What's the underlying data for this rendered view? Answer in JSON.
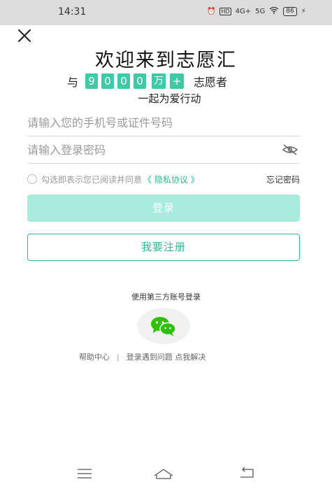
{
  "status_bar": {
    "time": "14:31",
    "icons": [
      "alarm-icon",
      "hd-icon",
      "4g-signal-icon",
      "5g-signal-icon",
      "wifi-icon"
    ],
    "hd_label": "HD",
    "net1_label": "4G+",
    "net2_label": "5G",
    "battery": "86"
  },
  "header": {
    "close_icon": "close-icon",
    "title": "欢迎来到志愿汇",
    "count_prefix": "与",
    "count_digits": [
      "9",
      "0",
      "0",
      "0"
    ],
    "count_unit": "万",
    "count_plus": "+",
    "count_suffix": "志愿者",
    "subtitle": "一起为爱行动"
  },
  "form": {
    "account_placeholder": "请输入您的手机号或证件号码",
    "account_value": "",
    "password_placeholder": "请输入登录密码",
    "password_value": "",
    "eye_icon": "eye-hidden-icon",
    "agree_text": "勾选即表示您已阅读并同意",
    "privacy_link": "《 隐私协议 》",
    "forgot_label": "忘记密码",
    "login_label": "登录",
    "register_label": "我要注册"
  },
  "third_party": {
    "label": "使用第三方账号登录",
    "wechat_icon": "wechat-icon"
  },
  "help": {
    "help_center": "帮助中心",
    "separator": "|",
    "issue_text": "登录遇到问题 点我解决"
  },
  "nav": {
    "menu_icon": "menu-icon",
    "home_icon": "home-icon",
    "back_icon": "back-icon"
  },
  "colors": {
    "accent": "#2bb894",
    "digit_bg": "#3fc9a7",
    "login_bg": "#a9ecdd"
  }
}
